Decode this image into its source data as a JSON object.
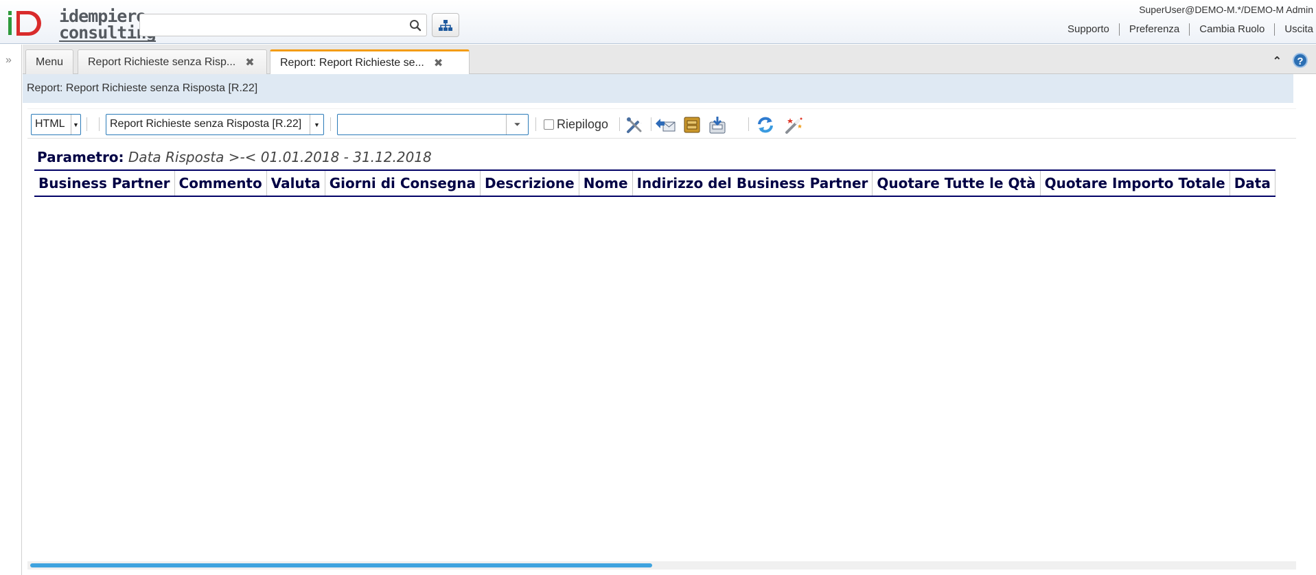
{
  "header": {
    "logo_line1": "idempiere",
    "logo_line2": "consulting",
    "search_placeholder": "",
    "user_info": "SuperUser@DEMO-M.*/DEMO-M Admin",
    "links": [
      "Supporto",
      "Preferenza",
      "Cambia Ruolo",
      "Uscita"
    ]
  },
  "tabs": [
    {
      "label": "Menu",
      "closable": false,
      "active": false
    },
    {
      "label": "Report Richieste senza Risp...",
      "closable": true,
      "active": false
    },
    {
      "label": "Report: Report Richieste se...",
      "closable": true,
      "active": true
    }
  ],
  "title": "Report: Report Richieste senza Risposta [R.22]",
  "toolbar": {
    "output_type": "HTML",
    "print_format": "Report Richieste senza Risposta [R.22]",
    "param_value": "",
    "summary_label": "Riepilogo",
    "summary_checked": false,
    "icons": [
      "customize-icon",
      "send-mail-icon",
      "archive-icon",
      "export-icon",
      "refresh-icon",
      "wizard-icon"
    ]
  },
  "report": {
    "param_label": "Parametro:",
    "param_value": "Data Risposta >-< 01.01.2018 - 31.12.2018",
    "columns": [
      "Business Partner",
      "Commento",
      "Valuta",
      "Giorni di Consegna",
      "Descrizione",
      "Nome",
      "Indirizzo del Business Partner",
      "Quotare Tutte le Qtà",
      "Quotare Importo Totale",
      "Data"
    ]
  },
  "colors": {
    "header_text": "#000044",
    "active_tab_accent": "#f39c12",
    "titlebar_bg": "#dfe9f3",
    "scroll_thumb": "#3fa3df"
  }
}
